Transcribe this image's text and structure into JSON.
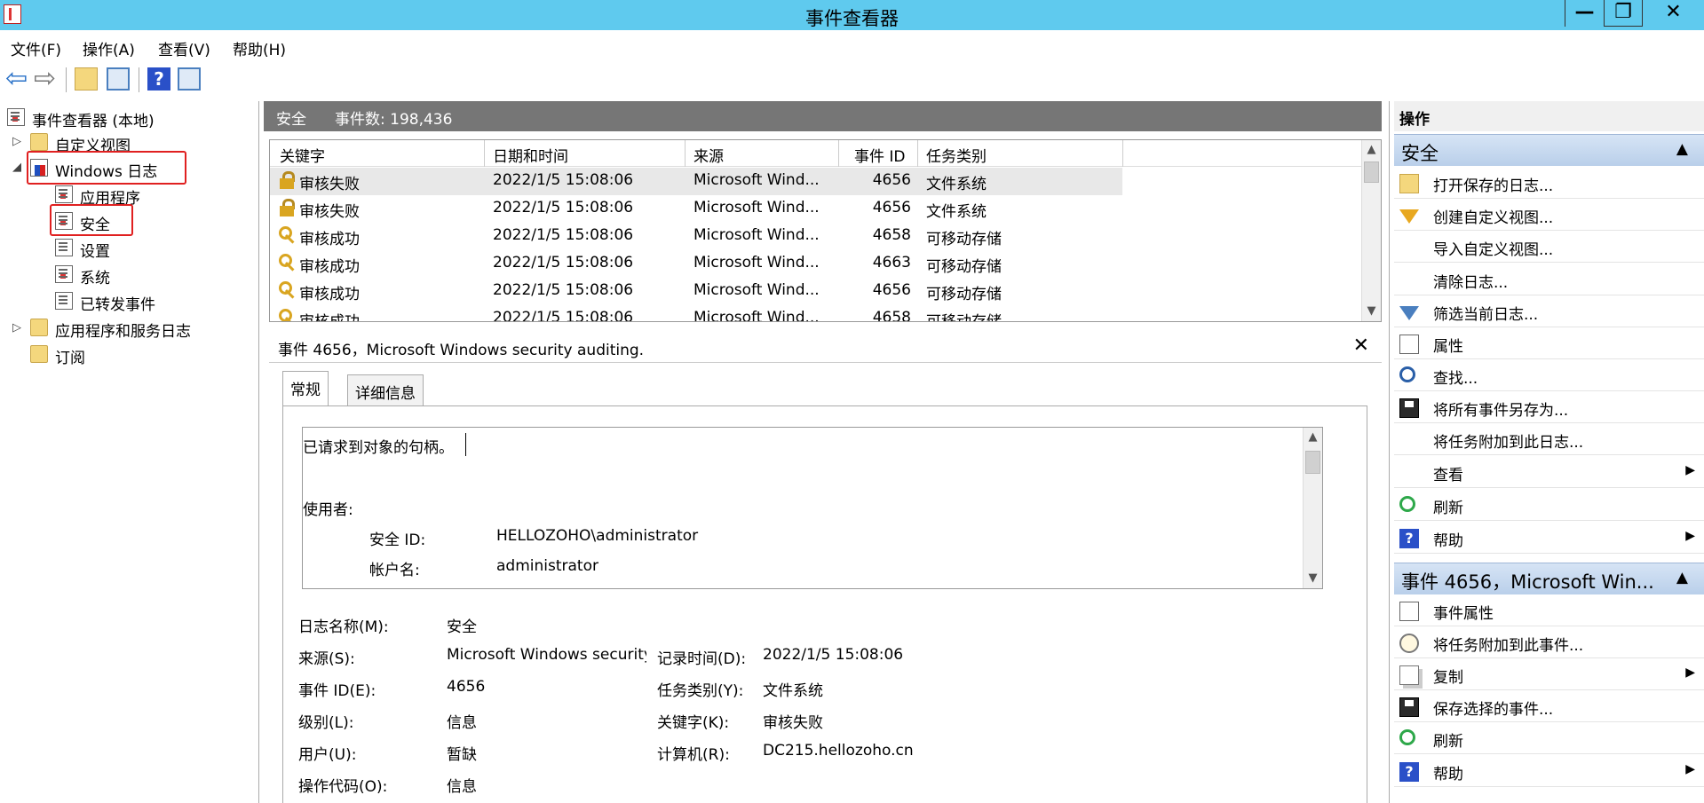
{
  "window": {
    "title": "事件查看器",
    "minimize": "—",
    "maximize": "❐",
    "close": "✕"
  },
  "menu": [
    "文件(F)",
    "操作(A)",
    "查看(V)",
    "帮助(H)"
  ],
  "toolbar": {
    "back": "⇦",
    "forward": "⇨",
    "help": "?"
  },
  "tree": {
    "root": "事件查看器 (本地)",
    "custom_views": "自定义视图",
    "windows_logs": "Windows 日志",
    "application": "应用程序",
    "security": "安全",
    "setup": "设置",
    "system": "系统",
    "forwarded": "已转发事件",
    "apps_services": "应用程序和服务日志",
    "subscriptions": "订阅",
    "expand_collapsed": "▷",
    "expand_open": "◢"
  },
  "log_header": {
    "name": "安全",
    "count": "事件数: 198,436"
  },
  "table": {
    "columns": [
      "关键字",
      "日期和时间",
      "来源",
      "事件 ID",
      "任务类别"
    ],
    "rows": [
      {
        "icon": "lock",
        "keyword": "审核失败",
        "datetime": "2022/1/5 15:08:06",
        "source": "Microsoft Wind...",
        "event_id": "4656",
        "task": "文件系统"
      },
      {
        "icon": "lock",
        "keyword": "审核失败",
        "datetime": "2022/1/5 15:08:06",
        "source": "Microsoft Wind...",
        "event_id": "4656",
        "task": "文件系统"
      },
      {
        "icon": "key",
        "keyword": "审核成功",
        "datetime": "2022/1/5 15:08:06",
        "source": "Microsoft Wind...",
        "event_id": "4658",
        "task": "可移动存储"
      },
      {
        "icon": "key",
        "keyword": "审核成功",
        "datetime": "2022/1/5 15:08:06",
        "source": "Microsoft Wind...",
        "event_id": "4663",
        "task": "可移动存储"
      },
      {
        "icon": "key",
        "keyword": "审核成功",
        "datetime": "2022/1/5 15:08:06",
        "source": "Microsoft Wind...",
        "event_id": "4656",
        "task": "可移动存储"
      },
      {
        "icon": "key",
        "keyword": "审核成功",
        "datetime": "2022/1/5 15:08:06",
        "source": "Microsoft Wind...",
        "event_id": "4658",
        "task": "可移动存储"
      }
    ]
  },
  "detail": {
    "header": "事件 4656，Microsoft Windows security auditing.",
    "close": "✕",
    "tabs": [
      "常规",
      "详细信息"
    ],
    "description": {
      "line1": "已请求到对象的句柄。",
      "subject_label": "使用者:",
      "security_id_label": "安全 ID:",
      "security_id_value": "HELLOZOHO\\administrator",
      "account_label": "帐户名:",
      "account_value": "administrator"
    },
    "props": {
      "log_name_label": "日志名称(M):",
      "log_name": "安全",
      "source_label": "来源(S):",
      "source": "Microsoft Windows security auditing.",
      "logged_label": "记录时间(D):",
      "logged": "2022/1/5 15:08:06",
      "event_id_label": "事件 ID(E):",
      "event_id": "4656",
      "task_label": "任务类别(Y):",
      "task": "文件系统",
      "level_label": "级别(L):",
      "level": "信息",
      "keywords_label": "关键字(K):",
      "keywords": "审核失败",
      "user_label": "用户(U):",
      "user": "暂缺",
      "computer_label": "计算机(R):",
      "computer": "DC215.hellozoho.cn",
      "opcode_label": "操作代码(O):",
      "opcode": "信息"
    }
  },
  "actions": {
    "title": "操作",
    "section1": "安全",
    "items1": [
      "打开保存的日志...",
      "创建自定义视图...",
      "导入自定义视图...",
      "清除日志...",
      "筛选当前日志...",
      "属性",
      "查找...",
      "将所有事件另存为...",
      "将任务附加到此日志...",
      "查看",
      "刷新",
      "帮助"
    ],
    "section2": "事件 4656，Microsoft Win...",
    "items2": [
      "事件属性",
      "将任务附加到此事件...",
      "复制",
      "保存选择的事件...",
      "刷新",
      "帮助"
    ],
    "submenu_arrow": "▶",
    "collapse_arrow": "▲"
  },
  "scroll": {
    "up": "▲",
    "down": "▼"
  }
}
